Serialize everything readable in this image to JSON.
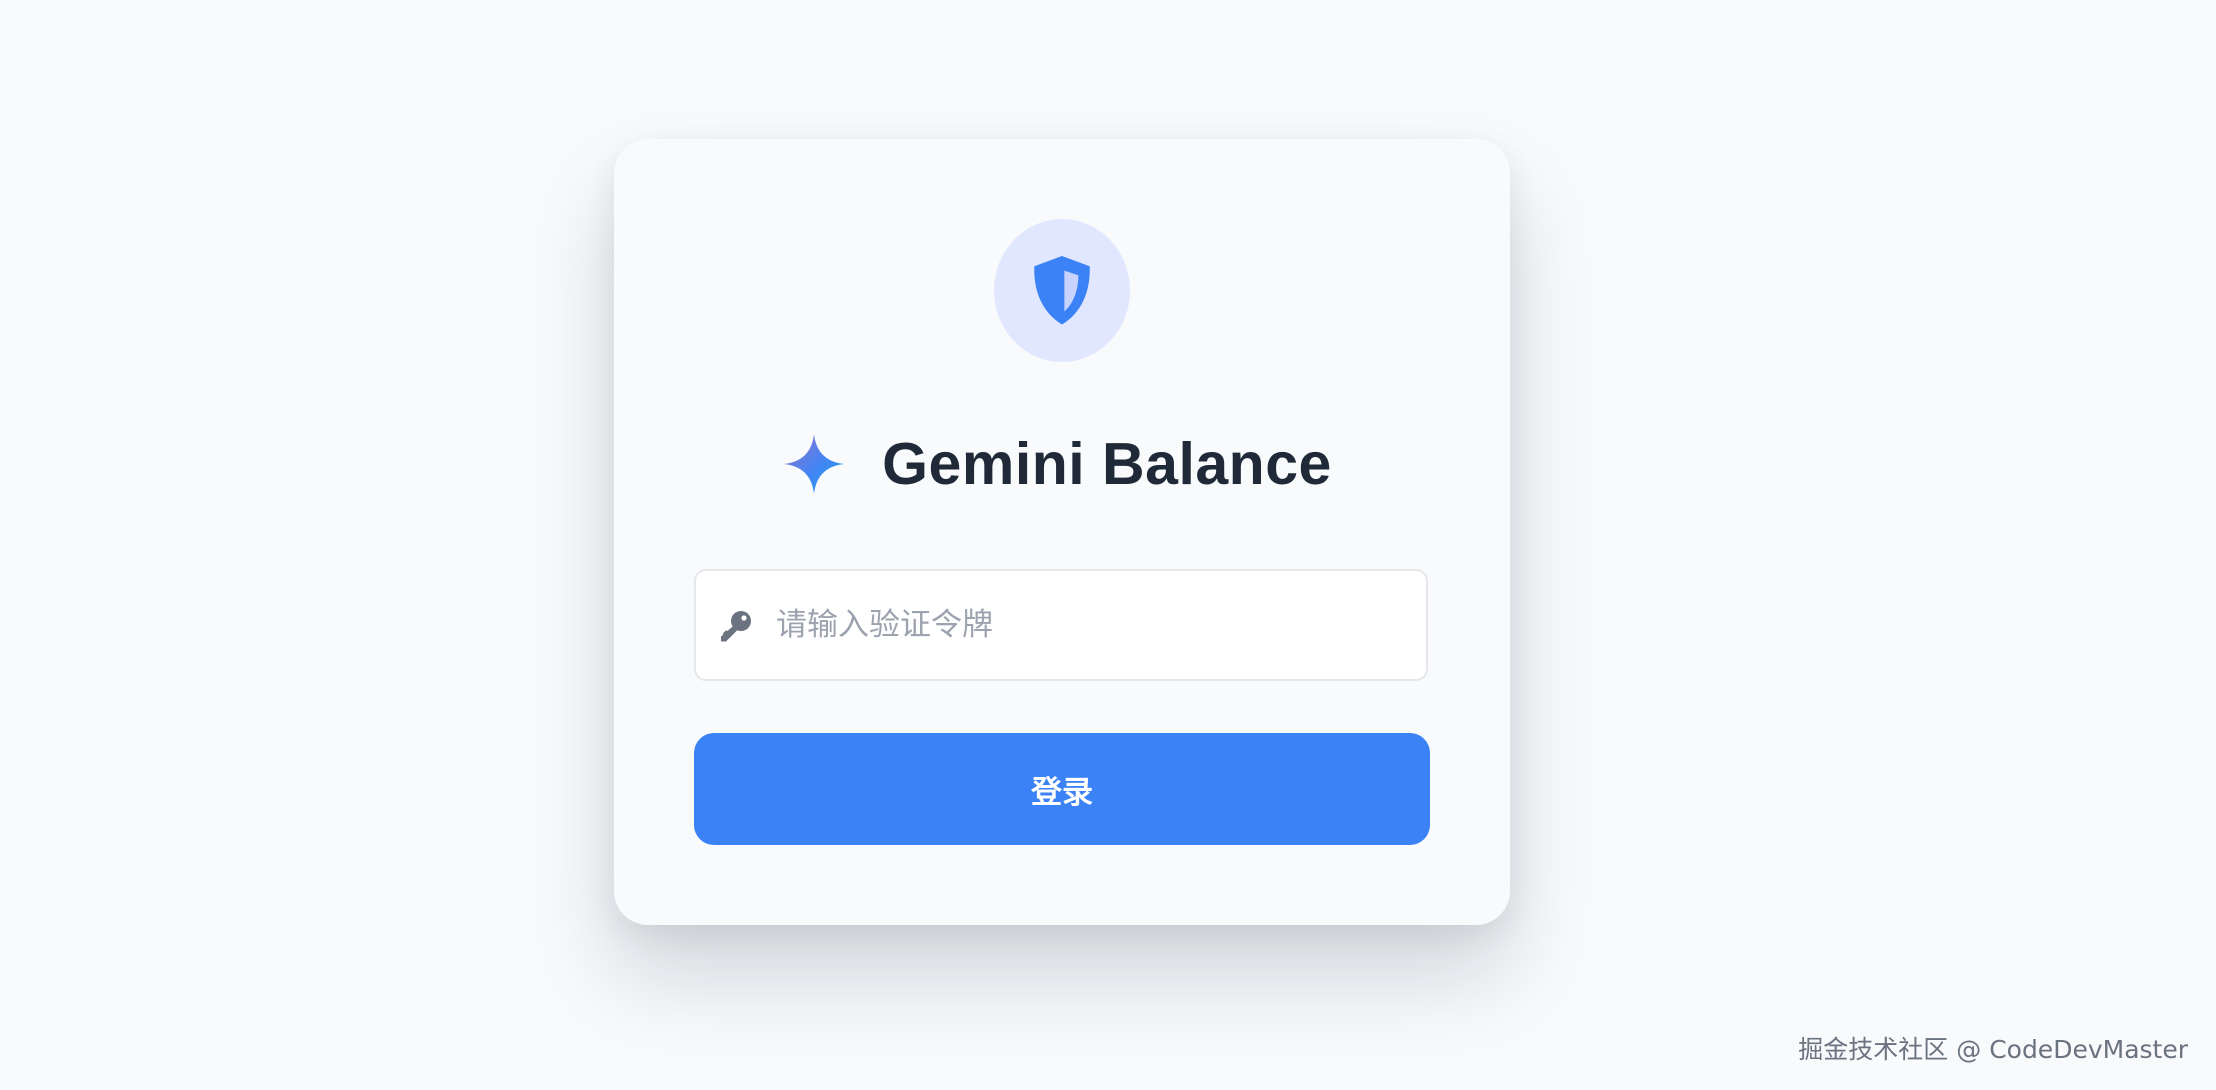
{
  "app": {
    "title": "Gemini Balance",
    "icons": {
      "badge": "shield-half-icon",
      "brand": "gemini-sparkle-icon",
      "input": "key-icon"
    }
  },
  "login": {
    "token_placeholder": "请输入验证令牌",
    "token_value": "",
    "submit_label": "登录"
  },
  "watermark": {
    "text": "掘金技术社区 @ CodeDevMaster"
  },
  "colors": {
    "background": "#f8fafc",
    "accent": "#3b82f6",
    "badge_bg": "#e0e7ff",
    "title": "#1f2937",
    "key_icon": "#6b7280",
    "sparkle_gradient": [
      "#9b72cb",
      "#4285f4",
      "#1ba1e3"
    ]
  }
}
